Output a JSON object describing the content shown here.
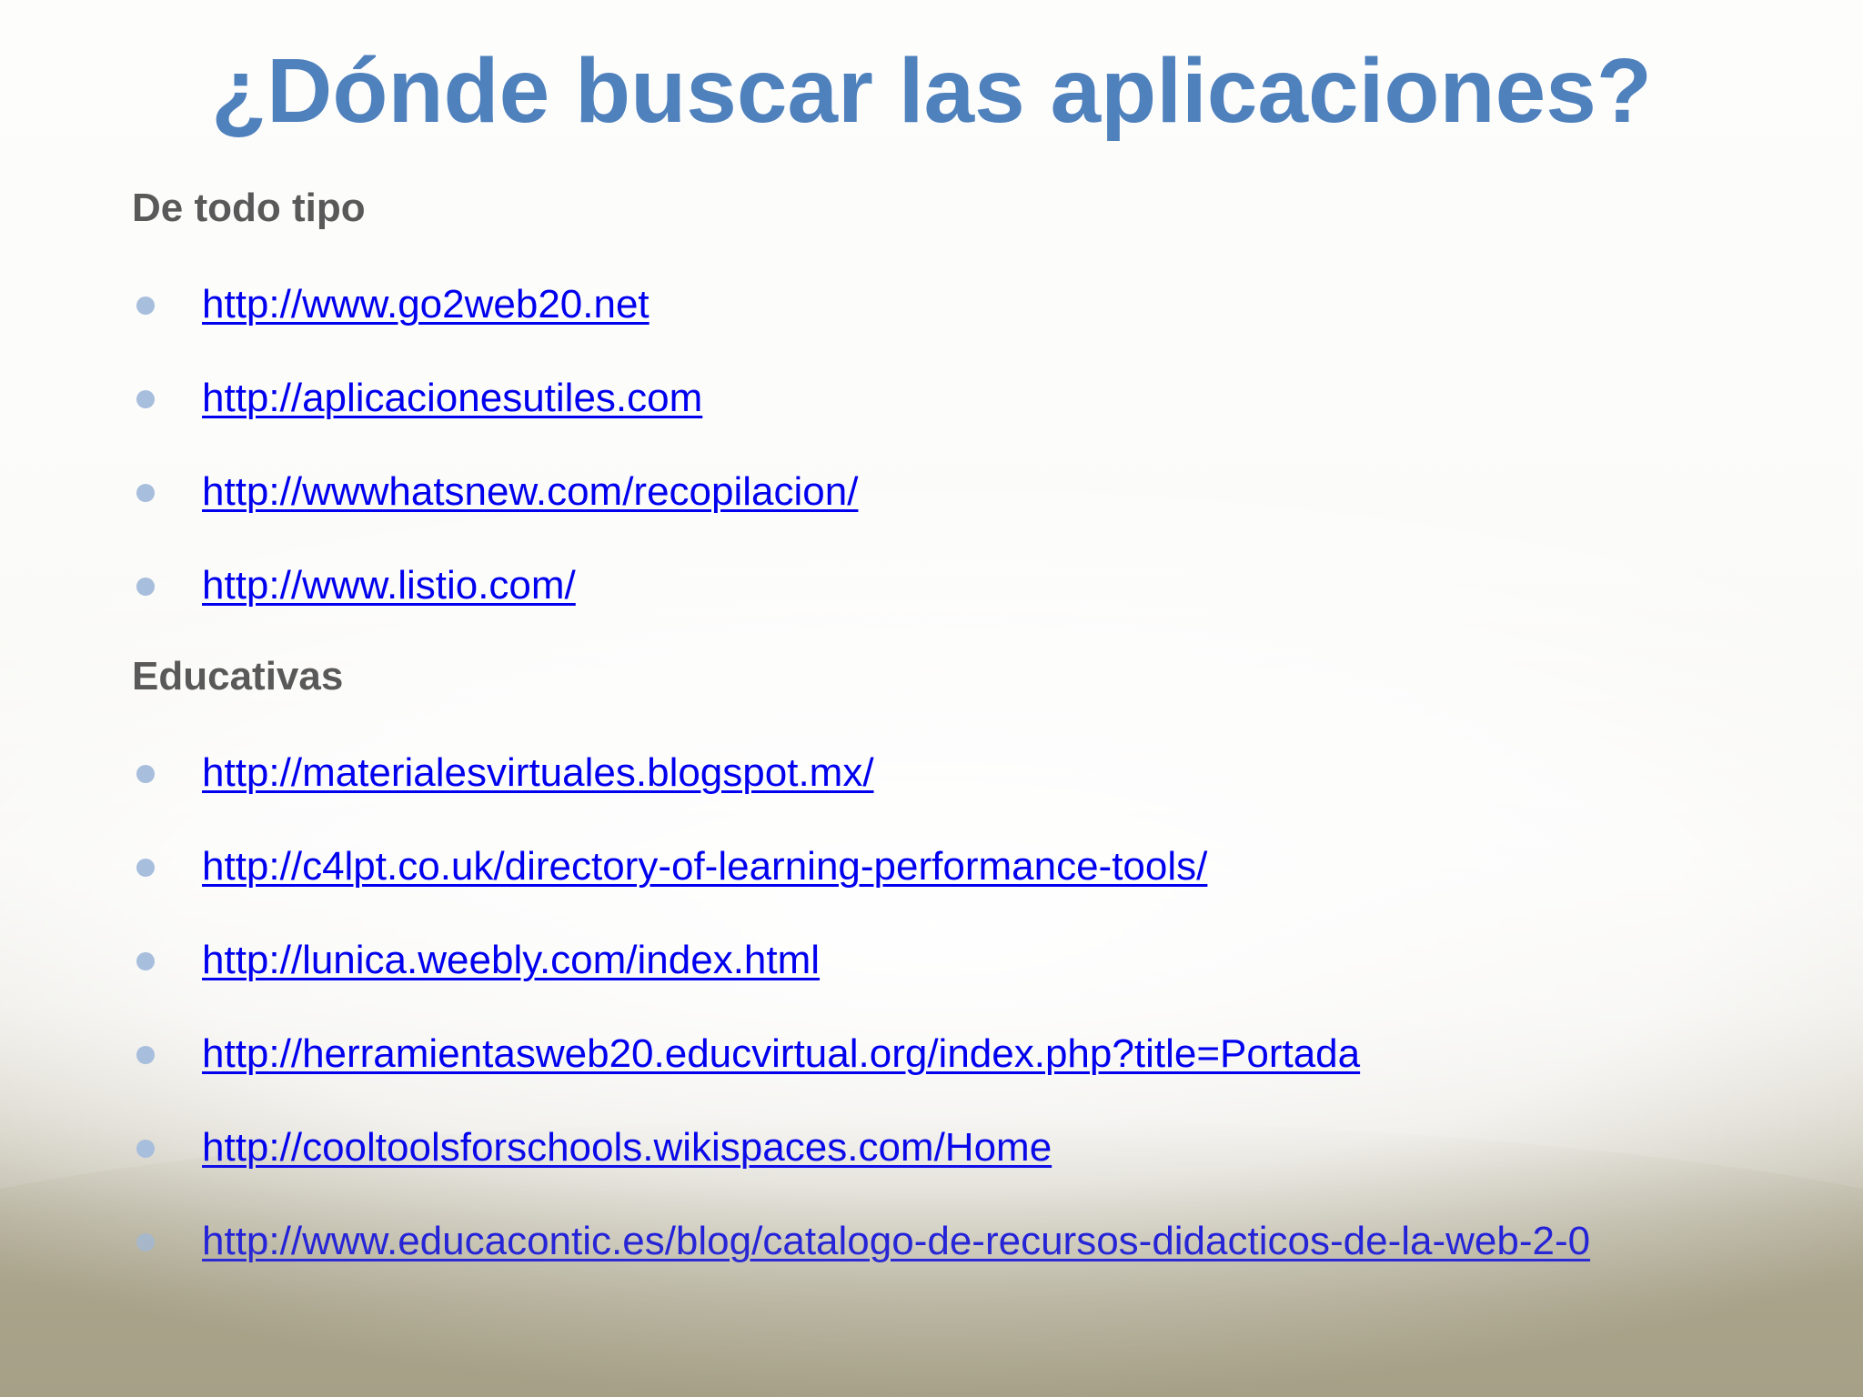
{
  "slide": {
    "title": "¿Dónde buscar las aplicaciones?",
    "colors": {
      "title": "#4f81bd",
      "heading": "#595959",
      "link": "#0000ee",
      "bullet": "#a7bedd"
    },
    "sections": [
      {
        "heading": "De todo tipo",
        "links": [
          "http://www.go2web20.net",
          "http://aplicacionesutiles.com",
          "http://wwwhatsnew.com/recopilacion/",
          "http://www.listio.com/"
        ]
      },
      {
        "heading": "Educativas",
        "links": [
          "http://materialesvirtuales.blogspot.mx/",
          "http://c4lpt.co.uk/directory-of-learning-performance-tools/",
          "http://lunica.weebly.com/index.html",
          "http://herramientasweb20.educvirtual.org/index.php?title=Portada",
          "http://cooltoolsforschools.wikispaces.com/Home",
          "http://www.educacontic.es/blog/catalogo-de-recursos-didacticos-de-la-web-2-0"
        ]
      }
    ]
  }
}
